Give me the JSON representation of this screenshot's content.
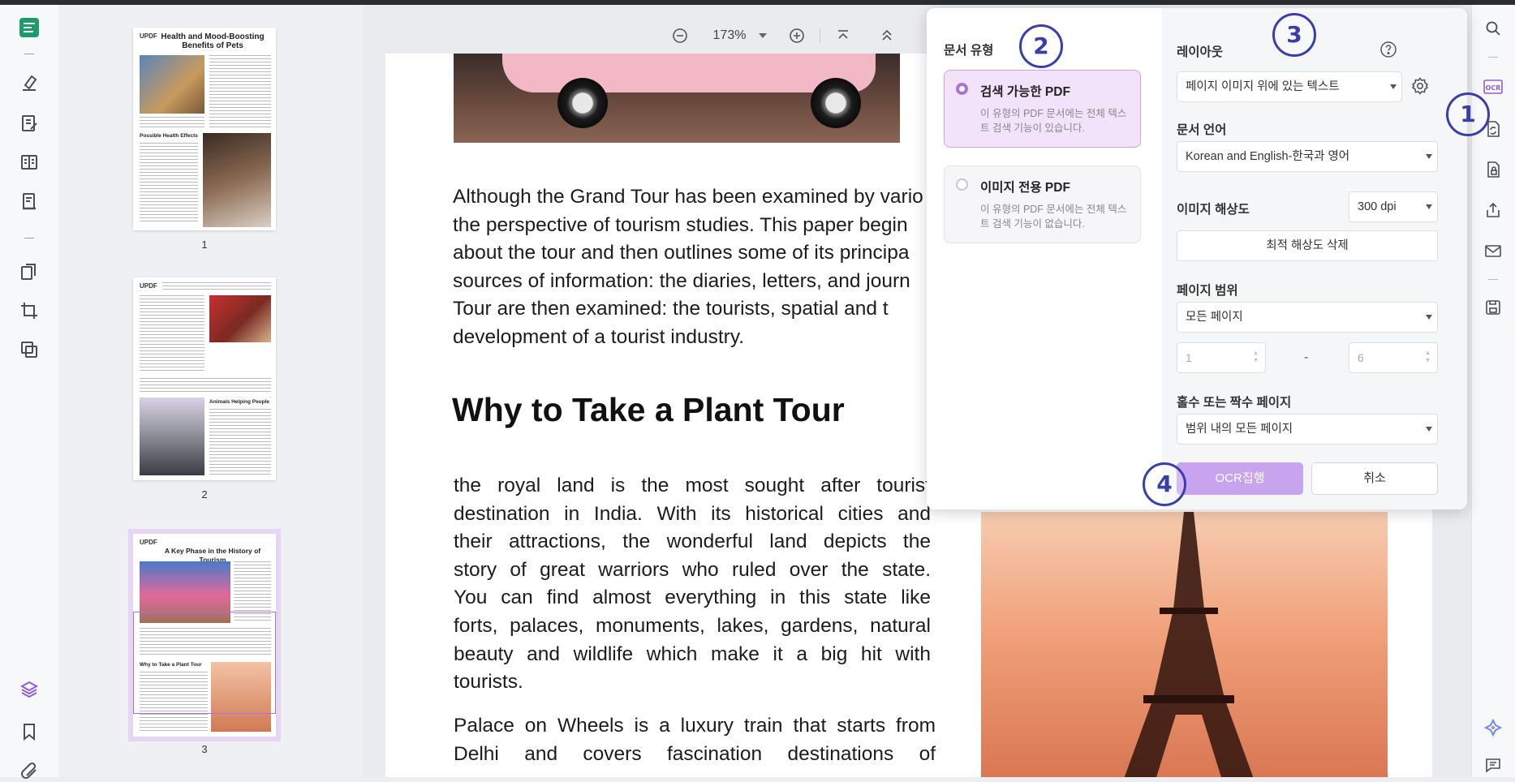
{
  "zoom": {
    "level": "173%"
  },
  "thumbnails": [
    {
      "page_number": "1",
      "title": "Health and Mood-Boosting Benefits of Pets",
      "subheading": "Possible Health Effects",
      "logo": "UPDF"
    },
    {
      "page_number": "2",
      "title": "",
      "subheading": "Animals Helping People",
      "logo": "UPDF"
    },
    {
      "page_number": "3",
      "title": "A Key Phase in the History of Tourism",
      "subheading": "Why to Take a Plant Tour",
      "logo": "UPDF"
    }
  ],
  "document": {
    "paragraph1": [
      "Although the Grand Tour has been examined by vario",
      "the perspective of tourism studies. This paper begin",
      "about the tour and then outlines some of its principa",
      "sources of information: the diaries, letters, and journ",
      "Tour are then examined: the tourists, spatial and t",
      "development of a tourist industry."
    ],
    "heading": "Why to Take a Plant Tour",
    "paragraph2": [
      "the royal land is the most sought after tourist",
      "destination in India. With its historical cities and",
      "their attractions, the wonderful land depicts the",
      "story of great warriors who ruled over the state.",
      "You can find almost everything in this state like",
      "forts, palaces, monuments, lakes, gardens, natural",
      "beauty and wildlife which make it a big hit with",
      "tourists."
    ],
    "paragraph3": [
      "Palace on Wheels is a luxury train that starts from",
      "Delhi and covers fascination destinations of"
    ]
  },
  "ocr_panel": {
    "document_type_label": "문서 유형",
    "types": [
      {
        "title": "검색 가능한 PDF",
        "description": "이 유형의 PDF 문서에는 전체 텍스트 검색 기능이 있습니다.",
        "selected": true
      },
      {
        "title": "이미지 전용 PDF",
        "description": "이 유형의 PDF 문서에는 전체 텍스트 검색 기능이 없습니다.",
        "selected": false
      }
    ],
    "layout_label": "레이아웃",
    "layout_value": "페이지 이미지 위에 있는 텍스트",
    "language_label": "문서 언어",
    "language_value": "Korean and English-한국과 영어",
    "resolution_label": "이미지 해상도",
    "resolution_value": "300 dpi",
    "detect_button": "최적 해상도 삭제",
    "page_range_label": "페이지 범위",
    "page_range_value": "모든 페이지",
    "range_from_placeholder": "1",
    "range_dash": "-",
    "range_to_placeholder": "6",
    "odd_even_label": "홀수 또는 짝수 페이지",
    "odd_even_value": "범위 내의 모든 페이지",
    "ocr_button": "OCR집행",
    "cancel_button": "취소"
  },
  "callouts": [
    "1",
    "2",
    "3",
    "4"
  ],
  "colors": {
    "accent": "#a874d8",
    "callout": "#3a3ea8",
    "ocr_button": "#c8a3ee"
  }
}
